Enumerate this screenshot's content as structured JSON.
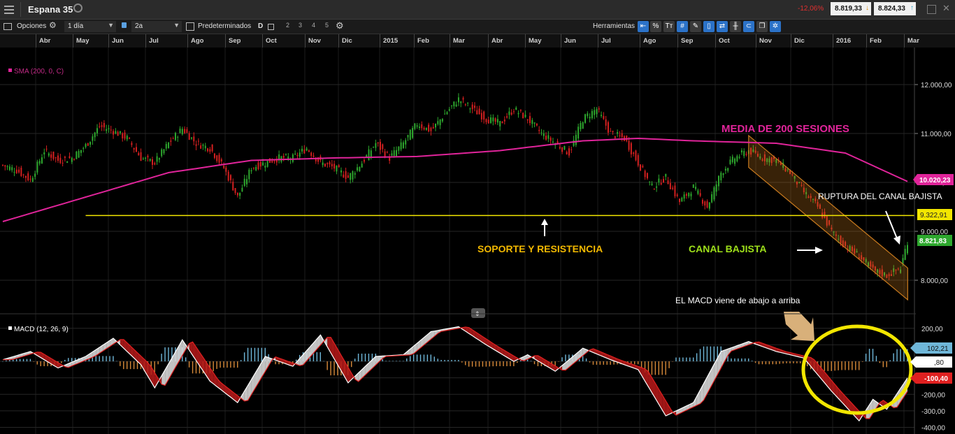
{
  "topbar": {
    "instrument": "Espana 35",
    "change": "-12,06%",
    "bid": "8.819,33",
    "ask": "8.824,33"
  },
  "toolbar": {
    "options": "Opciones",
    "interval": "1 día",
    "range": "2a",
    "presets": "Predeterminados",
    "d_label": "D",
    "numbers": [
      "2",
      "3",
      "4",
      "5"
    ],
    "tools": "Herramientas",
    "percent": "%",
    "tt": "Tт"
  },
  "colors": {
    "up": "#2ea82e",
    "down": "#d42020",
    "sma": "#e0249a",
    "support": "#f2e600",
    "channel": "#c87a1e",
    "macd_up": "#6fb7d9",
    "macd_down": "#d78a3a",
    "ellipse": "#f2e600"
  },
  "chart_data": [
    {
      "type": "candlestick",
      "name": "Espana 35 (IBEX 35), daily",
      "x": [
        "Abr",
        "May",
        "Jun",
        "Jul",
        "Ago",
        "Sep",
        "Oct",
        "Nov",
        "Dic",
        "2015",
        "Feb",
        "Mar",
        "Abr",
        "May",
        "Jun",
        "Jul",
        "Ago",
        "Sep",
        "Oct",
        "Nov",
        "Dic",
        "2016",
        "Feb",
        "Mar"
      ],
      "close_path": [
        [
          0,
          10350
        ],
        [
          2,
          10250
        ],
        [
          4,
          10050
        ],
        [
          6,
          10650
        ],
        [
          8,
          10450
        ],
        [
          10,
          10500
        ],
        [
          12,
          10750
        ],
        [
          14,
          11150
        ],
        [
          16,
          11050
        ],
        [
          18,
          10900
        ],
        [
          20,
          10500
        ],
        [
          22,
          10400
        ],
        [
          24,
          10800
        ],
        [
          26,
          11100
        ],
        [
          28,
          10800
        ],
        [
          30,
          10700
        ],
        [
          32,
          10300
        ],
        [
          34,
          9700
        ],
        [
          36,
          10300
        ],
        [
          38,
          10400
        ],
        [
          40,
          10500
        ],
        [
          42,
          10500
        ],
        [
          44,
          10700
        ],
        [
          46,
          10400
        ],
        [
          48,
          10300
        ],
        [
          50,
          10100
        ],
        [
          52,
          10400
        ],
        [
          54,
          10800
        ],
        [
          56,
          10500
        ],
        [
          58,
          10800
        ],
        [
          60,
          11200
        ],
        [
          62,
          11050
        ],
        [
          64,
          11400
        ],
        [
          66,
          11700
        ],
        [
          68,
          11500
        ],
        [
          70,
          11300
        ],
        [
          72,
          11200
        ],
        [
          74,
          11500
        ],
        [
          76,
          11300
        ],
        [
          78,
          11000
        ],
        [
          80,
          10800
        ],
        [
          82,
          10600
        ],
        [
          84,
          11300
        ],
        [
          86,
          11500
        ],
        [
          88,
          11000
        ],
        [
          90,
          10900
        ],
        [
          92,
          10400
        ],
        [
          94,
          9900
        ],
        [
          96,
          10100
        ],
        [
          98,
          9600
        ],
        [
          100,
          9900
        ],
        [
          102,
          9500
        ],
        [
          104,
          10200
        ],
        [
          106,
          10500
        ],
        [
          108,
          10650
        ],
        [
          110,
          10500
        ],
        [
          112,
          10450
        ],
        [
          114,
          10200
        ],
        [
          116,
          9800
        ],
        [
          118,
          9500
        ],
        [
          120,
          9000
        ],
        [
          122,
          8700
        ],
        [
          124,
          8500
        ],
        [
          126,
          8200
        ],
        [
          128,
          8100
        ],
        [
          130,
          8250
        ],
        [
          131,
          8800
        ]
      ],
      "sma200": [
        [
          0,
          9200
        ],
        [
          12,
          9700
        ],
        [
          24,
          10200
        ],
        [
          36,
          10450
        ],
        [
          48,
          10500
        ],
        [
          60,
          10530
        ],
        [
          72,
          10650
        ],
        [
          84,
          10850
        ],
        [
          92,
          10900
        ],
        [
          100,
          10850
        ],
        [
          112,
          10800
        ],
        [
          122,
          10600
        ],
        [
          131,
          10020
        ]
      ],
      "support_level": 9322.91,
      "channel": {
        "from": [
          108,
          10600
        ],
        "to": [
          128,
          8250
        ],
        "width": 650
      },
      "ylim": [
        7400,
        12400
      ],
      "yticks": [
        8000,
        9000,
        10000,
        11000,
        12000
      ],
      "ytick_labels": [
        "8.000,00",
        "9.000,00",
        "10.000,00",
        "11.000,00",
        "12.000,00"
      ],
      "labels": {
        "sma_legend": "SMA (200, 0, C)",
        "sma_price": "10.020,23",
        "support_price": "9.322,91",
        "last_price": "8.821,83",
        "annotation_sma": "MEDIA DE 200 SESIONES",
        "annotation_support": "SOPORTE Y RESISTENCIA",
        "annotation_channel": "CANAL BAJISTA",
        "annotation_breakout": "RUPTURA DEL CANAL BAJISTA",
        "annotation_macd": "EL MACD viene de abajo a arriba"
      }
    },
    {
      "type": "line",
      "name": "MACD (12, 26, 9)",
      "macd_path": [
        [
          0,
          10
        ],
        [
          4,
          60
        ],
        [
          8,
          -40
        ],
        [
          12,
          30
        ],
        [
          16,
          140
        ],
        [
          20,
          -20
        ],
        [
          22,
          -160
        ],
        [
          26,
          130
        ],
        [
          30,
          -120
        ],
        [
          34,
          -250
        ],
        [
          38,
          30
        ],
        [
          42,
          -30
        ],
        [
          46,
          160
        ],
        [
          50,
          -130
        ],
        [
          54,
          30
        ],
        [
          58,
          40
        ],
        [
          62,
          180
        ],
        [
          66,
          210
        ],
        [
          70,
          100
        ],
        [
          74,
          0
        ],
        [
          76,
          40
        ],
        [
          80,
          -60
        ],
        [
          84,
          80
        ],
        [
          88,
          10
        ],
        [
          92,
          -50
        ],
        [
          96,
          -330
        ],
        [
          100,
          -250
        ],
        [
          104,
          60
        ],
        [
          108,
          120
        ],
        [
          112,
          60
        ],
        [
          116,
          20
        ],
        [
          120,
          -180
        ],
        [
          124,
          -360
        ],
        [
          126,
          -230
        ],
        [
          128,
          -290
        ],
        [
          131,
          -100
        ]
      ],
      "ylim": [
        -440,
        250
      ],
      "yticks": [
        200,
        100,
        0,
        -100,
        -200,
        -300,
        -400
      ],
      "ytick_labels": [
        "200,00",
        "",
        "",
        "",
        "-200,00",
        "-300,00",
        "-400,00"
      ],
      "labels": {
        "legend": "MACD (12, 26, 9)",
        "hist_value": "102,21",
        "signal_value": ",80",
        "macd_value": "-100,40"
      }
    }
  ]
}
